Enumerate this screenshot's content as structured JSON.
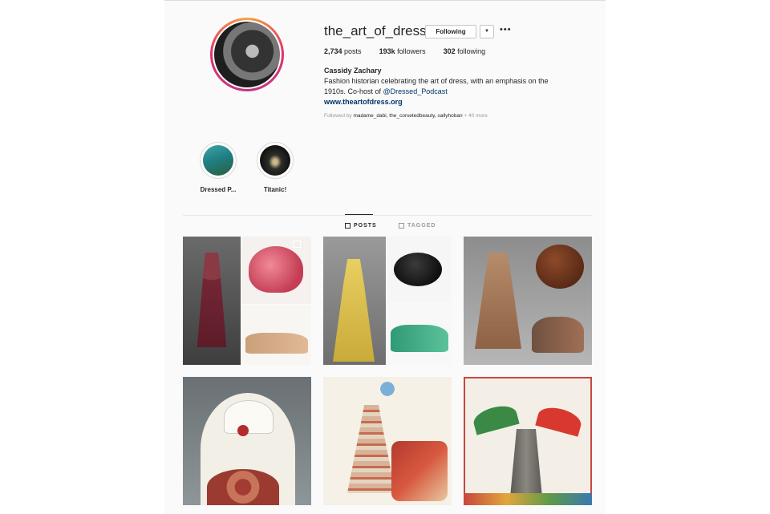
{
  "profile": {
    "username": "the_art_of_dress",
    "following_button": "Following",
    "dropdown_glyph": "▼",
    "more_glyph": "•••",
    "posts_count": "2,734",
    "posts_label": "posts",
    "followers_count": "193k",
    "followers_label": "followers",
    "following_count": "302",
    "following_label": "following",
    "full_name": "Cassidy Zachary",
    "bio_line1": "Fashion historian celebrating the art of dress, with an emphasis on the",
    "bio_line2_prefix": "1910s. Co-host of ",
    "bio_mention": "@Dressed_Podcast",
    "website": "www.theartofdress.org",
    "followed_by_prefix": "Followed by ",
    "followed_by_names": "madame_dabi, the_corsetedbeauty, sallyhoban",
    "followed_by_more": " + 40 more"
  },
  "highlights": [
    {
      "label": "Dressed P...",
      "icon": "dressed-highlight"
    },
    {
      "label": "Titanic!",
      "icon": "titanic-highlight"
    }
  ],
  "tabs": [
    {
      "label": "POSTS",
      "icon": "grid-icon",
      "active": true
    },
    {
      "label": "TAGGED",
      "icon": "tag-icon",
      "active": false
    }
  ],
  "posts": [
    {
      "description": "red dress, pink cloche hat and tan heeled shoes",
      "multi_icon": "multiple-photos-icon"
    },
    {
      "description": "yellow dress, black feathered hat and green heeled shoes"
    },
    {
      "description": "brown dress, brown turban hat and embroidered shoes"
    },
    {
      "description": "art deco illustration of woman in white hat"
    },
    {
      "description": "art deco illustration of woman and car"
    },
    {
      "description": "illustration of two women with umbrellas"
    }
  ],
  "colors": {
    "link": "#003569",
    "text": "#262626",
    "muted": "#999999",
    "page_bg": "#fafafa"
  }
}
